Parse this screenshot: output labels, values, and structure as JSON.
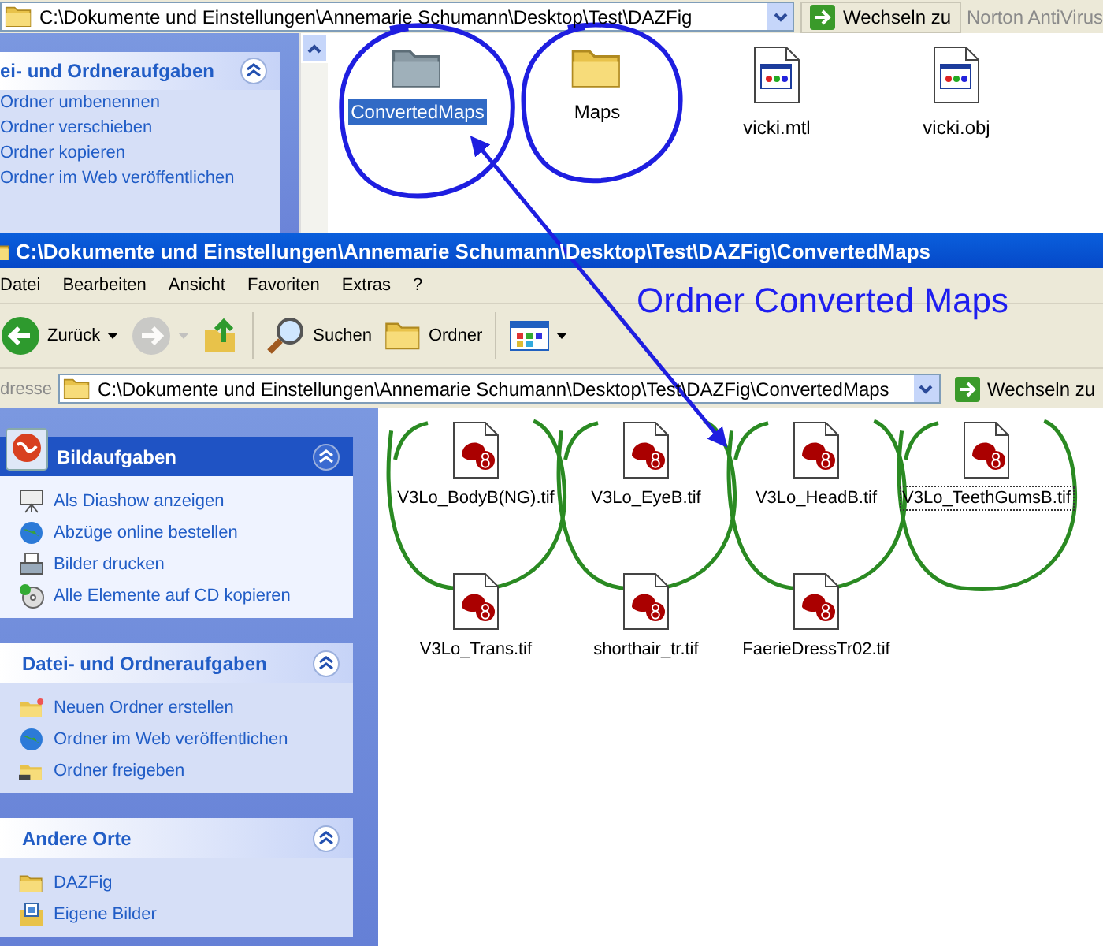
{
  "top_window": {
    "address": "C:\\Dokumente und Einstellungen\\Annemarie Schumann\\Desktop\\Test\\DAZFig",
    "go_label": "Wechseln zu",
    "toolbar_extra": "Norton AntiVirus",
    "task_panel": {
      "title": "ei- und Ordneraufgaben",
      "items": [
        "Ordner umbenennen",
        "Ordner verschieben",
        "Ordner kopieren",
        "Ordner im Web veröffentlichen"
      ]
    },
    "files": [
      {
        "name": "ConvertedMaps",
        "kind": "folder",
        "selected": true,
        "circled": true
      },
      {
        "name": "Maps",
        "kind": "folder",
        "selected": false,
        "circled": true
      },
      {
        "name": "vicki.mtl",
        "kind": "document",
        "selected": false,
        "circled": false
      },
      {
        "name": "vicki.obj",
        "kind": "document",
        "selected": false,
        "circled": false
      }
    ]
  },
  "bottom_window": {
    "title": "C:\\Dokumente und Einstellungen\\Annemarie Schumann\\Desktop\\Test\\DAZFig\\ConvertedMaps",
    "menu": [
      "Datei",
      "Bearbeiten",
      "Ansicht",
      "Favoriten",
      "Extras",
      "?"
    ],
    "toolbar": [
      {
        "kind": "back",
        "label": "Zurück",
        "disabled": false
      },
      {
        "kind": "forward",
        "disabled": true
      },
      {
        "kind": "up",
        "disabled": false
      },
      {
        "kind": "separator"
      },
      {
        "kind": "search",
        "label": "Suchen",
        "disabled": false
      },
      {
        "kind": "folders",
        "label": "Ordner",
        "disabled": false
      },
      {
        "kind": "separator"
      },
      {
        "kind": "views",
        "disabled": false
      }
    ],
    "address_label": "dresse",
    "address": "C:\\Dokumente und Einstellungen\\Annemarie Schumann\\Desktop\\Test\\DAZFig\\ConvertedMaps",
    "go_label": "Wechseln zu",
    "task_panels": [
      {
        "title": "Bildaufgaben",
        "kind": "featured",
        "items": [
          "Als Diashow anzeigen",
          "Abzüge online bestellen",
          "Bilder drucken",
          "Alle Elemente auf CD kopieren"
        ]
      },
      {
        "title": "Datei- und Ordneraufgaben",
        "kind": "plain",
        "items": [
          "Neuen Ordner erstellen",
          "Ordner im Web veröffentlichen",
          "Ordner freigeben"
        ]
      },
      {
        "title": "Andere Orte",
        "kind": "plain",
        "items": [
          "DAZFig",
          "Eigene Bilder"
        ]
      }
    ],
    "files": [
      {
        "name": "V3Lo_BodyB(NG).tif",
        "circled": true,
        "focused": false
      },
      {
        "name": "V3Lo_EyeB.tif",
        "circled": true,
        "focused": false
      },
      {
        "name": "V3Lo_HeadB.tif",
        "circled": true,
        "focused": false
      },
      {
        "name": "V3Lo_TeethGumsB.tif",
        "circled": true,
        "focused": true
      },
      {
        "name": "V3Lo_Trans.tif",
        "circled": false,
        "focused": false
      },
      {
        "name": "shorthair_tr.tif",
        "circled": false,
        "focused": false
      },
      {
        "name": "FaerieDressTr02.tif",
        "circled": false,
        "focused": false
      }
    ]
  },
  "annotation": {
    "caption": "Ordner Converted Maps"
  }
}
